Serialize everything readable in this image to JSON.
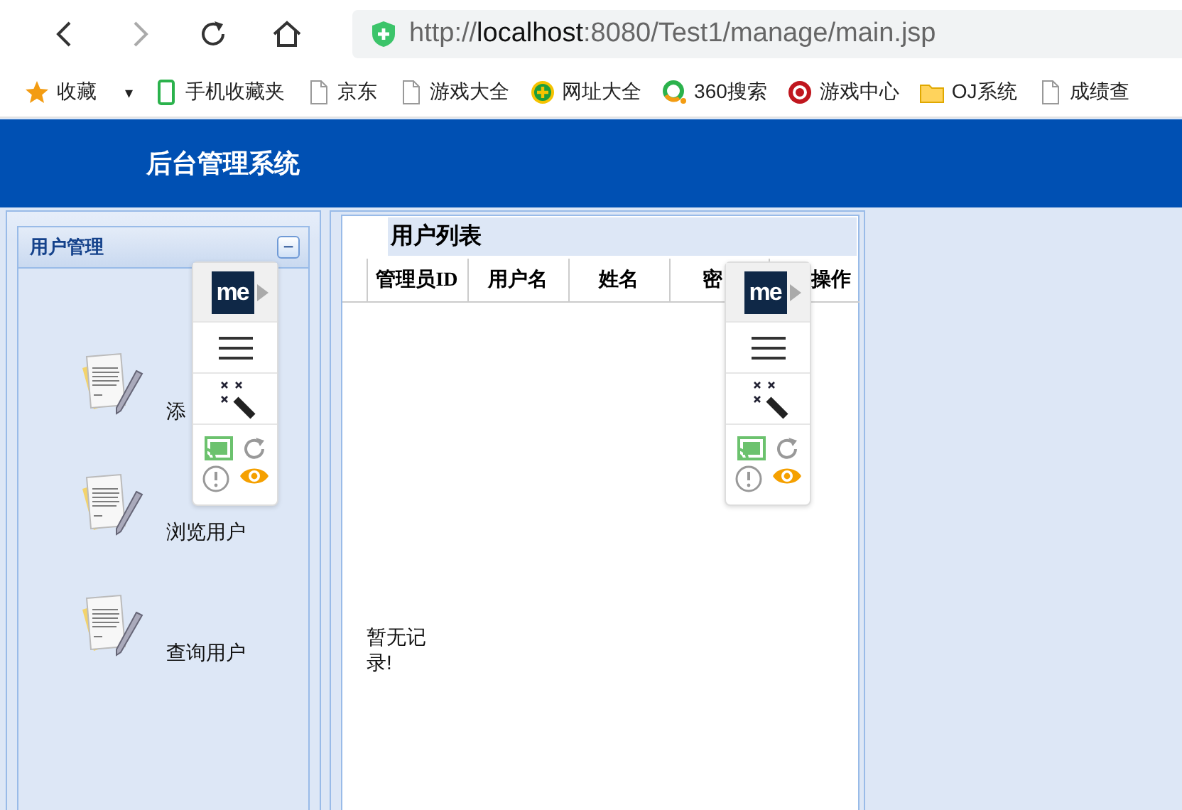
{
  "browser": {
    "url": {
      "scheme": "http://",
      "host": "localhost",
      "rest": ":8080/Test1/manage/main.jsp"
    },
    "bookmarks": [
      {
        "label": "收藏",
        "kind": "star",
        "dropdown": "▾"
      },
      {
        "label": "手机收藏夹",
        "kind": "phone"
      },
      {
        "label": "京东",
        "kind": "page"
      },
      {
        "label": "游戏大全",
        "kind": "page"
      },
      {
        "label": "网址大全",
        "kind": "plus"
      },
      {
        "label": "360搜索",
        "kind": "ring"
      },
      {
        "label": "游戏中心",
        "kind": "game"
      },
      {
        "label": "OJ系统",
        "kind": "folder"
      },
      {
        "label": "成绩查",
        "kind": "page"
      }
    ]
  },
  "header": {
    "title": "后台管理系统"
  },
  "sidebar": {
    "title": "用户管理",
    "collapse": "−",
    "items": [
      {
        "label": "添"
      },
      {
        "label": "浏览用户"
      },
      {
        "label": "查询用户"
      }
    ]
  },
  "user_list": {
    "title": "用户列表",
    "columns": [
      "管理员ID",
      "用户名",
      "姓名",
      "密",
      "操作"
    ],
    "empty_message": "暂无记录!"
  },
  "popups": [
    {
      "logo": "me"
    },
    {
      "logo": "me"
    }
  ]
}
